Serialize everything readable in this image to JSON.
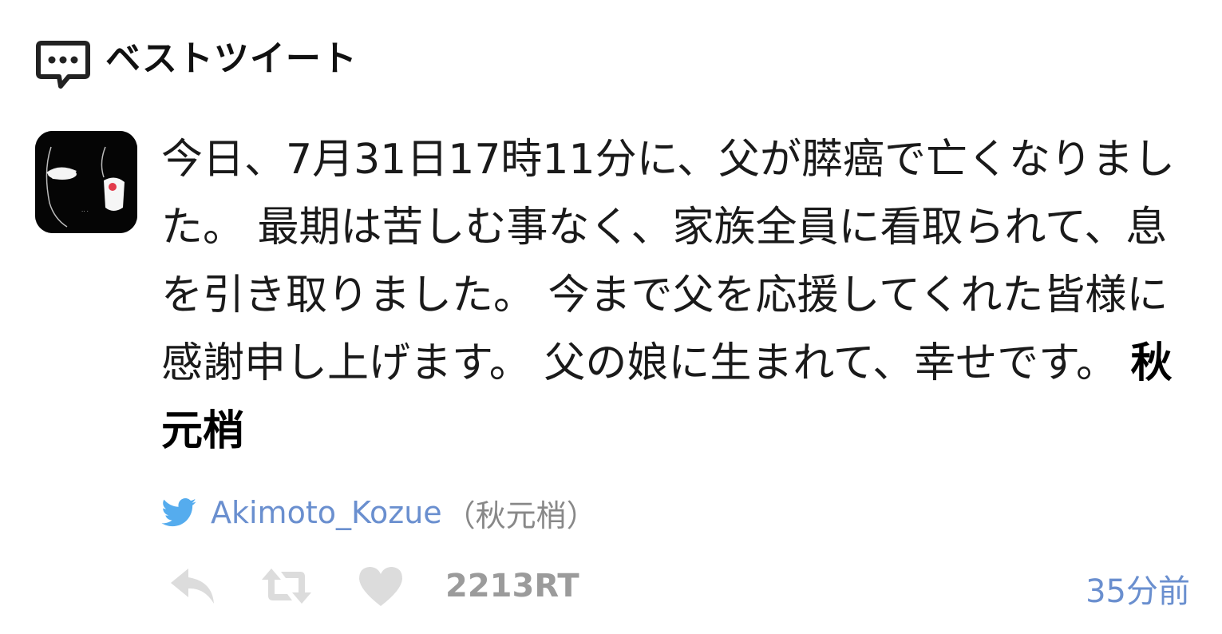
{
  "header": {
    "icon": "speech-bubble-icon",
    "title": "ベストツイート"
  },
  "tweet": {
    "avatar": "user-avatar",
    "text": "今日、7月31日17時11分に、父が膵癌で亡くなりました。 最期は苦しむ事なく、家族全員に看取られて、息を引き取りました。 今まで父を応援してくれた皆様に感謝申し上げます。 父の娘に生まれて、幸せです。 ",
    "signature": "秋元梢",
    "author": {
      "icon": "twitter-bird-icon",
      "handle": "Akimoto_Kozue",
      "name": "（秋元梢）"
    },
    "actions": {
      "reply_icon": "reply-icon",
      "retweet_icon": "retweet-icon",
      "like_icon": "heart-icon",
      "retweet_count": "2213RT"
    },
    "timestamp": "35分前"
  },
  "colors": {
    "link_blue": "#6a8fcf",
    "action_gray": "#d9d9d9",
    "count_gray": "#9b9b9b",
    "twitter_blue": "#55acee"
  }
}
